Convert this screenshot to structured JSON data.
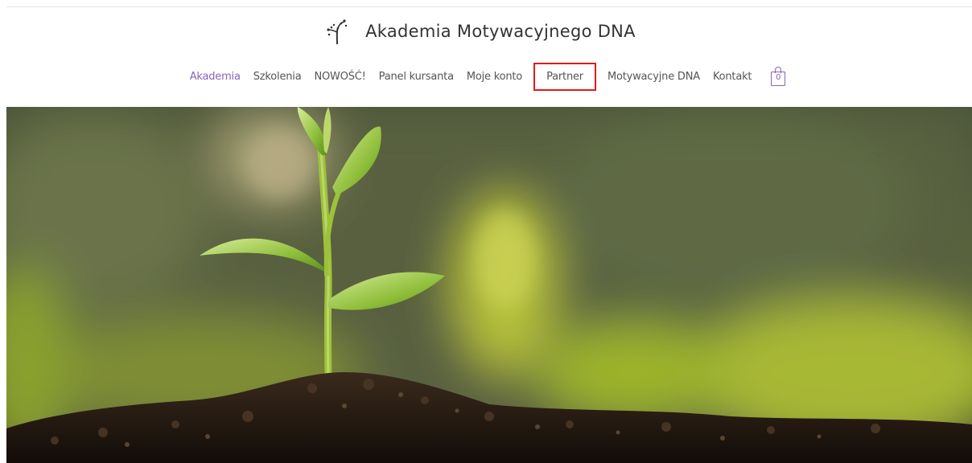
{
  "site": {
    "title": "Akademia Motywacyjnego DNA",
    "logo_icon": "sprout-logo-icon"
  },
  "nav": {
    "items": [
      {
        "label": "Akademia",
        "active": true
      },
      {
        "label": "Szkolenia"
      },
      {
        "label": "NOWOŚĆ!"
      },
      {
        "label": "Panel kursanta"
      },
      {
        "label": "Moje konto"
      },
      {
        "label": "Partner",
        "highlighted": true
      },
      {
        "label": "Motywacyjne DNA"
      },
      {
        "label": "Kontakt"
      }
    ],
    "cart_count": "0",
    "cart_icon": "shopping-bag-icon"
  },
  "hero": {
    "image": "seedling-in-soil-photo"
  },
  "colors": {
    "accent": "#8a63b8",
    "highlight_border": "#e01b1b",
    "text": "#555555"
  }
}
